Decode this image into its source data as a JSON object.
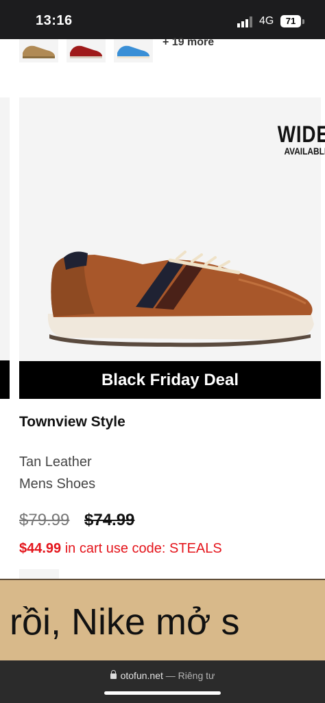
{
  "status_bar": {
    "time": "13:16",
    "network": "4G",
    "battery": "71"
  },
  "product": {
    "more_colors": "+ 19 more",
    "badge_line1": "WIDE",
    "badge_line2": "AVAILABLE",
    "deal_label": "Black Friday Deal",
    "style": "Townview Style",
    "color": "Tan Leather",
    "category": "Mens Shoes",
    "price_original": "$79.99",
    "price_regular": "$74.99",
    "sale_price": "$44.99",
    "sale_text": " in cart use code: STEALS"
  },
  "banner": {
    "text": "y rồi, Nike mở s"
  },
  "browser": {
    "domain": "otofun.net",
    "separator": " — ",
    "privacy": "Riêng tư"
  },
  "colors": {
    "sale_red": "#e4141b",
    "banner_bg": "#d8b98a",
    "deal_bg": "#000000"
  }
}
